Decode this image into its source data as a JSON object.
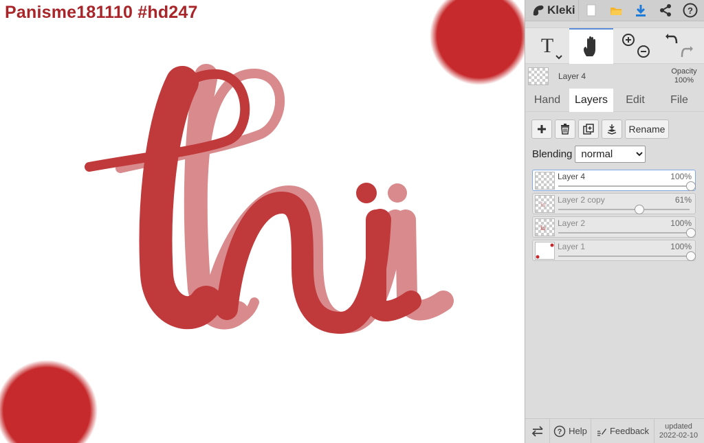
{
  "canvas": {
    "title": "Panisme181110 #hd247",
    "accent_red": "#c62a2c"
  },
  "app": {
    "name": "Kleki"
  },
  "topbar": {
    "icons": [
      "kleki-logo-icon",
      "new-image-icon",
      "open-folder-icon",
      "download-icon",
      "share-icon",
      "help-circle-icon"
    ]
  },
  "tools": {
    "text": "T",
    "active": "hand"
  },
  "current_layer": {
    "name": "Layer 4",
    "opacity_label": "Opacity",
    "opacity_value": "100%"
  },
  "tabs": [
    {
      "label": "Hand"
    },
    {
      "label": "Layers"
    },
    {
      "label": "Edit"
    },
    {
      "label": "File"
    }
  ],
  "layer_actions": {
    "rename_label": "Rename"
  },
  "blending": {
    "label": "Blending",
    "value": "normal"
  },
  "layers": [
    {
      "name": "Layer 4",
      "opacity": "100%",
      "opacity_fraction": 1.0
    },
    {
      "name": "Layer 2 copy",
      "opacity": "61%",
      "opacity_fraction": 0.61
    },
    {
      "name": "Layer 2",
      "opacity": "100%",
      "opacity_fraction": 1.0
    },
    {
      "name": "Layer 1",
      "opacity": "100%",
      "opacity_fraction": 1.0
    }
  ],
  "bottombar": {
    "help_label": "Help",
    "feedback_label": "Feedback",
    "updated_label": "updated",
    "updated_date": "2022-02-10"
  }
}
